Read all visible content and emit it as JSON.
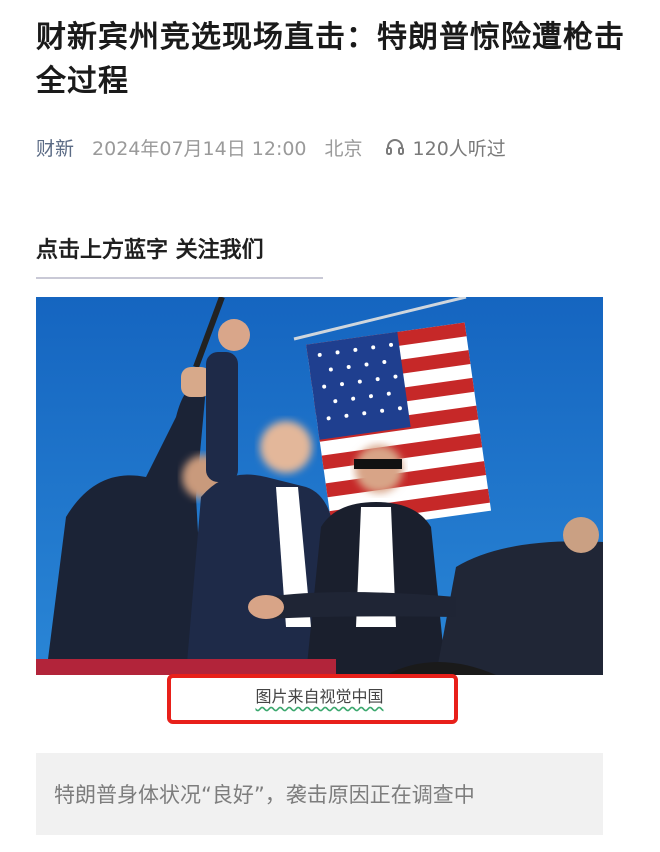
{
  "article": {
    "title": "财新宾州竞选现场直击：特朗普惊险遭枪击全过程",
    "meta": {
      "source": "财新",
      "date": "2024年07月14日 12:00",
      "location": "北京",
      "listen_count": "120人听过",
      "listen_icon": "headphones-icon"
    },
    "follow_text": "点击上方蓝字  关注我们",
    "image": {
      "description_icon": "news-photo",
      "caption": "图片来自视觉中国"
    },
    "summary": "特朗普身体状况“良好”，袭击原因正在调查中"
  },
  "colors": {
    "highlight_border": "#e8201a",
    "source": "#5b6b85",
    "sky": "#1d6fc7",
    "caption_underline": "#3aa76d"
  }
}
